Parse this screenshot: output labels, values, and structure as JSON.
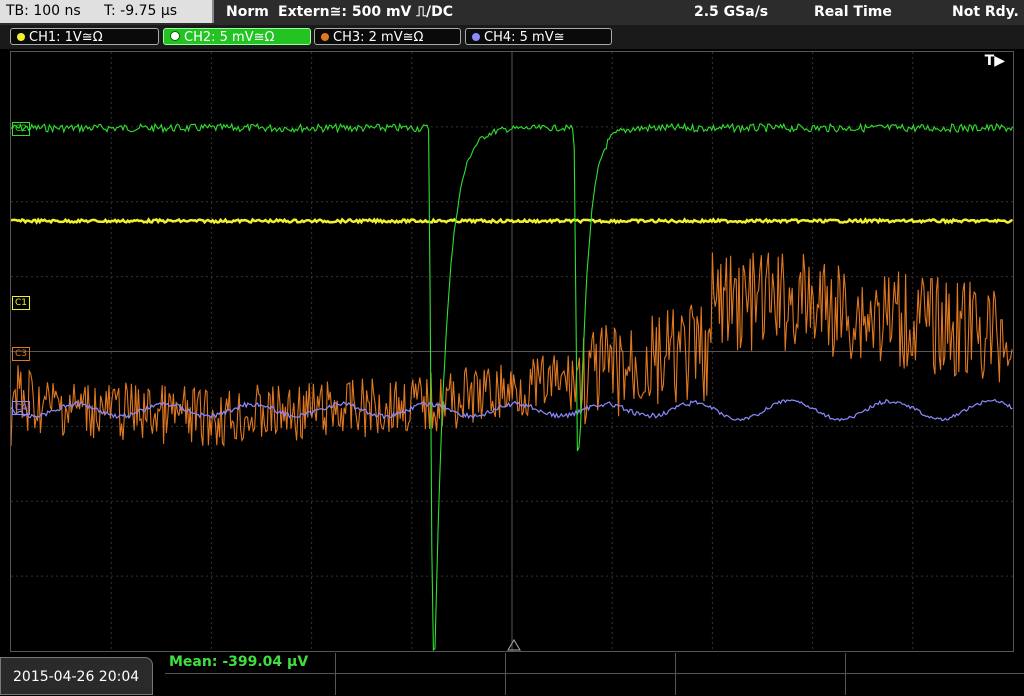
{
  "topbar": {
    "timebase": "TB: 100 ns",
    "trigger_time": "T: -9.75 µs",
    "mode": "Norm",
    "trigger_source": "Extern≅: 500 mV ⎍/DC",
    "sample_rate": "2.5 GSa/s",
    "acq_mode": "Real Time",
    "status": "Not Rdy."
  },
  "channels": [
    {
      "label": "CH1: 1V≅Ω",
      "color": "#f0f030"
    },
    {
      "label": "CH2: 5 mV≅Ω",
      "color": "#2fe02f"
    },
    {
      "label": "CH3: 2 mV≅Ω",
      "color": "#e07820"
    },
    {
      "label": "CH4: 5 mV≅",
      "color": "#8a8aff"
    }
  ],
  "markers": {
    "trigger": "T▶",
    "c1": "C1",
    "c2": "C2",
    "c3": "C3",
    "c4": "C4"
  },
  "footer": {
    "datetime": "2015-04-26 20:04",
    "mean": "Mean: -399.04 µV"
  }
}
